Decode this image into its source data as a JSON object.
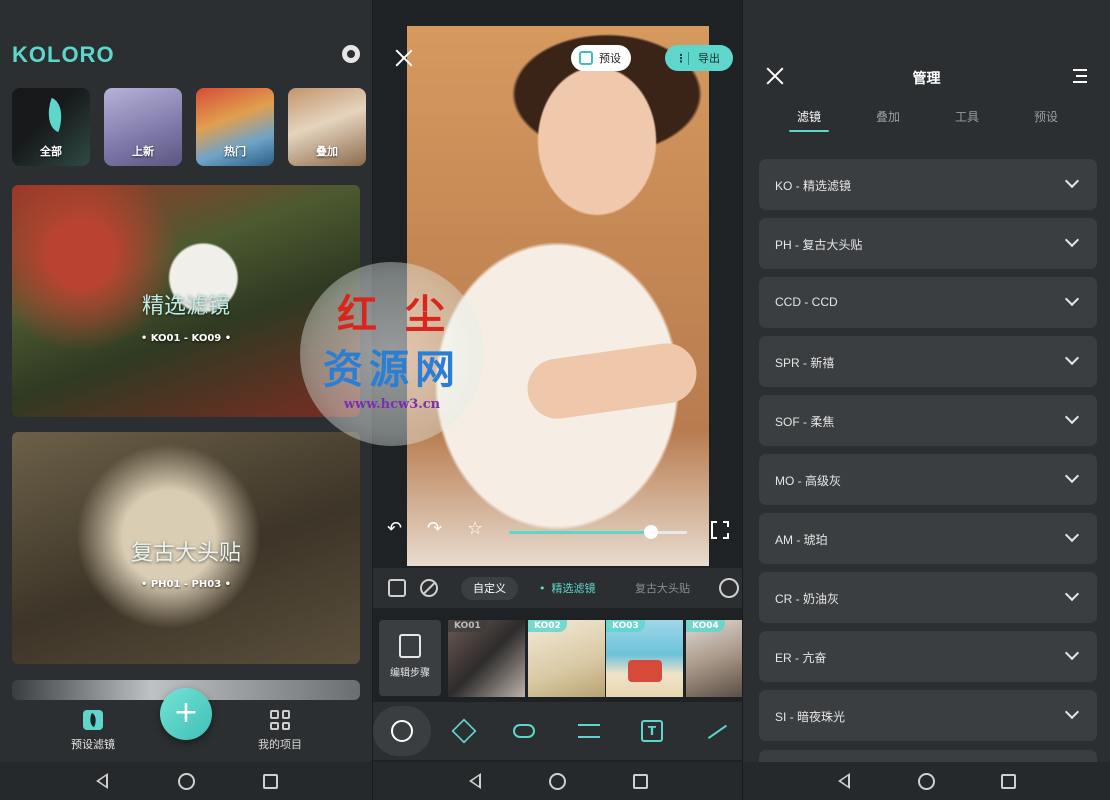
{
  "left": {
    "logo": "KOLORO",
    "categories": [
      {
        "label": "全部"
      },
      {
        "label": "上新"
      },
      {
        "label": "热门"
      },
      {
        "label": "叠加"
      }
    ],
    "cards": [
      {
        "title": "精选滤镜",
        "subtitle": "• KO01 - KO09 •"
      },
      {
        "title": "复古大头贴",
        "subtitle": "• PH01 - PH03 •"
      }
    ],
    "bottom_nav": {
      "preset": "预设滤镜",
      "projects": "我的项目",
      "add": "+"
    }
  },
  "middle": {
    "preset_label": "预设",
    "export_label": "导出",
    "export_dots": "⋮",
    "undo": "↶",
    "redo": "↷",
    "star": "☆",
    "intensity": 0.8,
    "chips": {
      "custom": "自定义",
      "selected": "精选滤镜",
      "next": "复古大头贴"
    },
    "edit_steps": "编辑步骤",
    "thumbs": [
      "KO01",
      "KO02",
      "KO03",
      "KO04"
    ],
    "text_tool": "T"
  },
  "right": {
    "title": "管理",
    "tabs": [
      "滤镜",
      "叠加",
      "工具",
      "预设"
    ],
    "groups": [
      "KO - 精选滤镜",
      "PH - 复古大头贴",
      "CCD - CCD",
      "SPR - 新禧",
      "SOF - 柔焦",
      "MO - 高级灰",
      "AM - 琥珀",
      "CR - 奶油灰",
      "ER - 亢奋",
      "SI - 暗夜珠光"
    ]
  },
  "watermark": {
    "line1": "红尘",
    "line2": "资源网",
    "line3": "www.hcw3.cn"
  },
  "colors": {
    "accent": "#5fd6cc",
    "background": "#2c2f31",
    "card": "#3a3e41"
  }
}
